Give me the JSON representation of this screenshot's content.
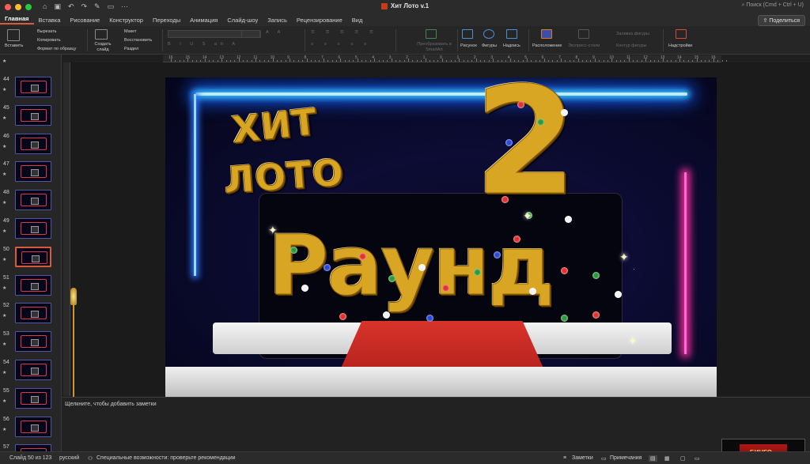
{
  "titlebar": {
    "doc_title": "Хит Лото v.1",
    "search_placeholder": "Поиск (Cmd + Ctrl + U)",
    "traffic_colors": [
      "#ff5f57",
      "#febc2e",
      "#28c840"
    ]
  },
  "tabs": [
    "Главная",
    "Вставка",
    "Рисование",
    "Конструктор",
    "Переходы",
    "Анимация",
    "Слайд-шоу",
    "Запись",
    "Рецензирование",
    "Вид"
  ],
  "active_tab": "Главная",
  "share_label": "Поделиться",
  "ribbon": {
    "paste": "Вставить",
    "cut": "Вырезать",
    "copy": "Копировать",
    "format_painter": "Формат по образцу",
    "new_slide": "Создать слайд",
    "layout": "Макет",
    "reset": "Восстановить",
    "section": "Раздел",
    "smartart": "Преобразовать в SmartArt",
    "picture": "Рисунок",
    "shapes": "Фигуры",
    "textbox": "Надпись",
    "arrange": "Расположение",
    "quick_styles": "Экспресс-стили",
    "shape_fill": "Заливка фигуры",
    "shape_outline": "Контур фигуры",
    "addins": "Надстройки"
  },
  "ruler_numbers": [
    "16",
    "15",
    "14",
    "13",
    "12",
    "11",
    "10",
    "9",
    "8",
    "7",
    "6",
    "5",
    "4",
    "3",
    "2",
    "1",
    "0",
    "1",
    "2",
    "3",
    "4",
    "5",
    "6",
    "7",
    "8",
    "9",
    "10",
    "11",
    "12",
    "13",
    "14",
    "15",
    "16"
  ],
  "thumbnails": [
    {
      "num": "44",
      "text": ""
    },
    {
      "num": "45",
      "text": ""
    },
    {
      "num": "46",
      "text": ""
    },
    {
      "num": "47",
      "text": ""
    },
    {
      "num": "48",
      "text": ""
    },
    {
      "num": "49",
      "text": ""
    },
    {
      "num": "50",
      "text": "",
      "selected": true
    },
    {
      "num": "51",
      "text": ""
    },
    {
      "num": "52",
      "text": ""
    },
    {
      "num": "53",
      "text": ""
    },
    {
      "num": "54",
      "text": ""
    },
    {
      "num": "55",
      "text": ""
    },
    {
      "num": "56",
      "text": ""
    },
    {
      "num": "57",
      "text": ""
    }
  ],
  "slide": {
    "line1": "ХИТ",
    "line2": "ЛОТО",
    "number": "2",
    "round": "Раунд"
  },
  "notes_placeholder": "Щелкните, чтобы добавить заметки",
  "status": {
    "slide_counter": "Слайд 50 из 123",
    "language": "русский",
    "accessibility": "Специальные возможности: проверьте рекомендации",
    "notes_btn": "Заметки",
    "comments_btn": "Примечания"
  },
  "mini_preview_text": "БИНГО"
}
